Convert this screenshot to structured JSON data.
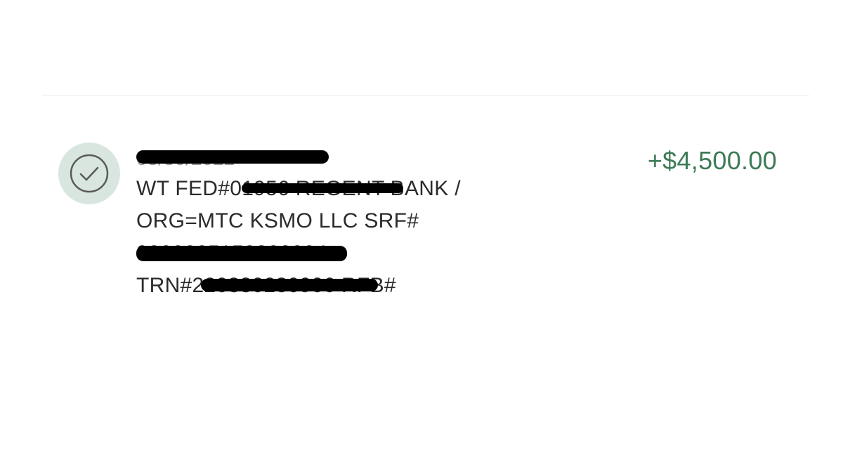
{
  "transaction": {
    "status_icon": "check-circle-icon",
    "date": "03/30/2022",
    "desc_line1": "WT FED#01956 REGENT BANK /",
    "desc_line2": "ORG=MTC KSMO LLC SRF#",
    "desc_line3": "0000225152800004",
    "desc_line4": "TRN#220330280906 RFB#",
    "amount": "+$4,500.00",
    "amount_color": "#3d7a55",
    "icon_bg_color": "#d9e6df"
  }
}
